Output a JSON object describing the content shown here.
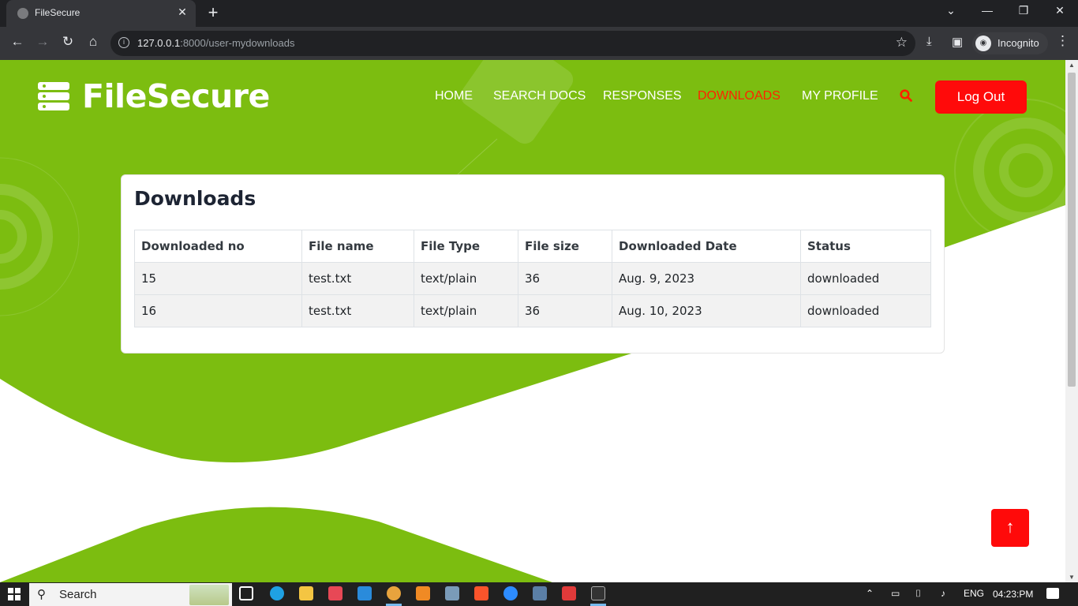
{
  "browser": {
    "tab_title": "FileSecure",
    "url_host": "127.0.0.1",
    "url_path": ":8000/user-mydownloads",
    "profile_label": "Incognito"
  },
  "site": {
    "brand": "FileSecure",
    "nav": [
      "HOME",
      "SEARCH DOCS",
      "RESPONSES",
      "DOWNLOADS",
      "MY PROFILE"
    ],
    "active_nav": "DOWNLOADS",
    "logout_label": "Log Out",
    "accent_green": "#7cbd10",
    "accent_red": "#ff0a0a"
  },
  "downloads": {
    "title": "Downloads",
    "columns": [
      "Downloaded no",
      "File name",
      "File Type",
      "File size",
      "Downloaded Date",
      "Status"
    ],
    "rows": [
      [
        "15",
        "test.txt",
        "text/plain",
        "36",
        "Aug. 9, 2023",
        "downloaded"
      ],
      [
        "16",
        "test.txt",
        "text/plain",
        "36",
        "Aug. 10, 2023",
        "downloaded"
      ]
    ]
  },
  "taskbar": {
    "search_label": "Search",
    "language": "ENG",
    "time": "04:23:PM"
  }
}
